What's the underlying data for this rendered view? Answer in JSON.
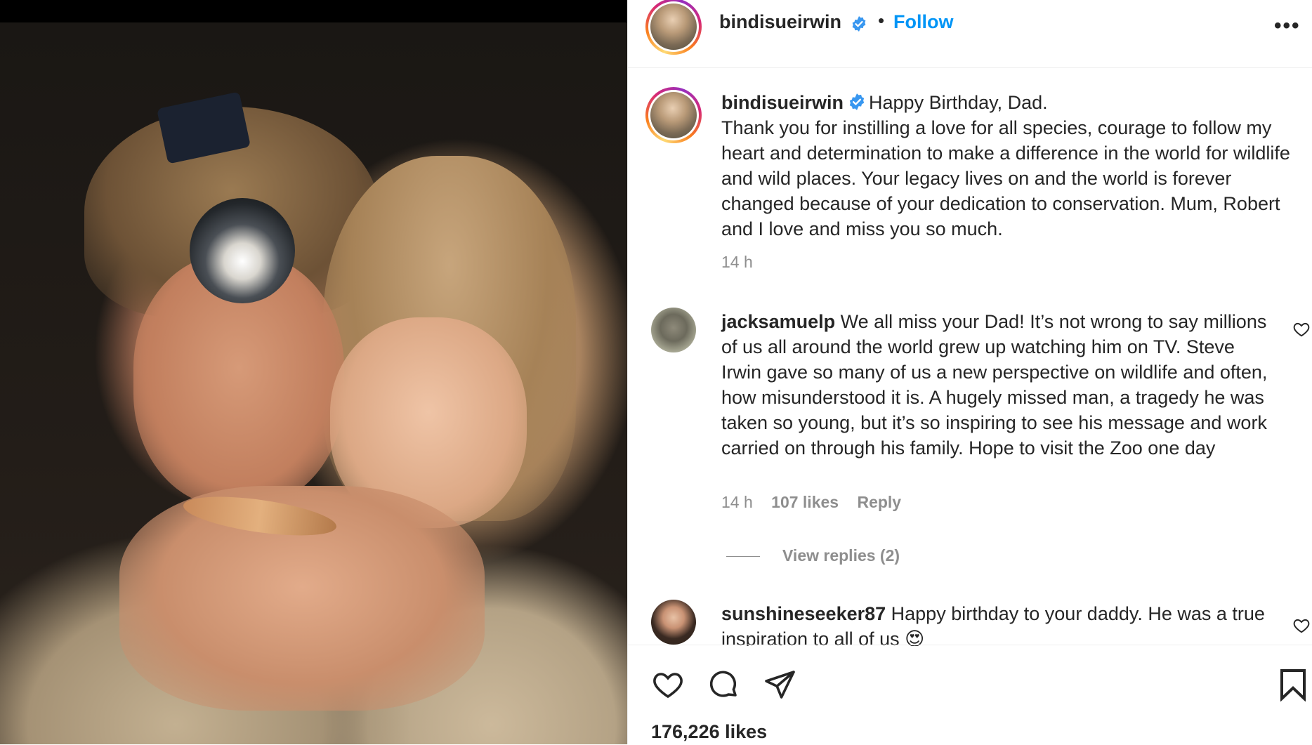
{
  "post": {
    "author": "bindisueirwin",
    "follow_label": "Follow",
    "separator": "•",
    "more_label": "•••",
    "caption_first_line": "Happy Birthday, Dad.",
    "caption_body": "Thank you for instilling a love for all species, courage to follow my heart and determination to make a difference in the world for wildlife and wild places. Your legacy lives on and the world is forever changed because of your dedication to conservation. Mum, Robert and I love and miss you so much.",
    "caption_time": "14 h",
    "likes": "176,226 likes"
  },
  "comments": [
    {
      "username": "jacksamuelp",
      "text": "We all miss your Dad! It’s not wrong to say millions of us all around the world grew up watching him on TV. Steve Irwin gave so many of us a new perspective on wildlife and often, how misunderstood it is. A hugely missed man, a tragedy he was taken so young, but it’s so inspiring to see his message and work carried on through his family. Hope to visit the Zoo one day",
      "time": "14 h",
      "likes": "107 likes",
      "reply_label": "Reply",
      "view_replies": "View replies (2)"
    },
    {
      "username": "sunshineseeker87",
      "text": "Happy birthday to your daddy. He was a true inspiration to all of us 😍"
    }
  ],
  "icons": {
    "verified": "verified-badge-icon",
    "like": "heart-icon",
    "comment": "comment-bubble-icon",
    "share": "paper-plane-icon",
    "save": "bookmark-icon",
    "more": "more-options-icon"
  },
  "colors": {
    "link_blue": "#0095f6",
    "verified_blue": "#3897f0",
    "secondary_text": "#8e8e8e",
    "primary_text": "#262626"
  }
}
